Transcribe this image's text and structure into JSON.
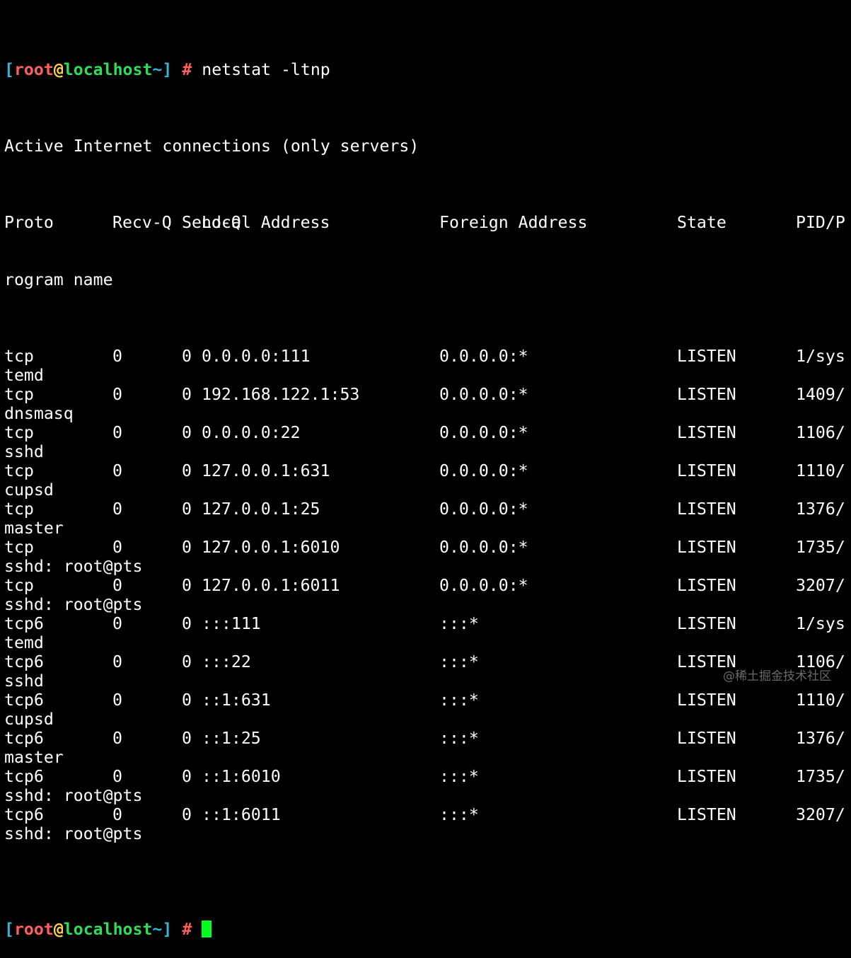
{
  "prompt": {
    "open_bracket": "[",
    "user": "root",
    "at": "@",
    "host": "localhost",
    "tilde": "~",
    "close_bracket": "]",
    "hash": "#"
  },
  "command": "netstat -ltnp",
  "title_line": "Active Internet connections (only servers)",
  "header": {
    "proto": "Proto",
    "recvq": "Recv-Q",
    "sendq": "Send-Q",
    "local": "Local Address",
    "foreign": "Foreign Address",
    "state": "State",
    "pid_head": "PID/P",
    "pid_tail": "rogram name"
  },
  "rows": [
    {
      "proto": "tcp",
      "recvq": "0",
      "sendq": "0",
      "local": "0.0.0.0:111",
      "foreign": "0.0.0.0:*",
      "state": "LISTEN",
      "pid_head": "1/sys",
      "pid_tail": "temd"
    },
    {
      "proto": "tcp",
      "recvq": "0",
      "sendq": "0",
      "local": "192.168.122.1:53",
      "foreign": "0.0.0.0:*",
      "state": "LISTEN",
      "pid_head": "1409/",
      "pid_tail": "dnsmasq"
    },
    {
      "proto": "tcp",
      "recvq": "0",
      "sendq": "0",
      "local": "0.0.0.0:22",
      "foreign": "0.0.0.0:*",
      "state": "LISTEN",
      "pid_head": "1106/",
      "pid_tail": "sshd"
    },
    {
      "proto": "tcp",
      "recvq": "0",
      "sendq": "0",
      "local": "127.0.0.1:631",
      "foreign": "0.0.0.0:*",
      "state": "LISTEN",
      "pid_head": "1110/",
      "pid_tail": "cupsd"
    },
    {
      "proto": "tcp",
      "recvq": "0",
      "sendq": "0",
      "local": "127.0.0.1:25",
      "foreign": "0.0.0.0:*",
      "state": "LISTEN",
      "pid_head": "1376/",
      "pid_tail": "master"
    },
    {
      "proto": "tcp",
      "recvq": "0",
      "sendq": "0",
      "local": "127.0.0.1:6010",
      "foreign": "0.0.0.0:*",
      "state": "LISTEN",
      "pid_head": "1735/",
      "pid_tail": "sshd: root@pts"
    },
    {
      "proto": "tcp",
      "recvq": "0",
      "sendq": "0",
      "local": "127.0.0.1:6011",
      "foreign": "0.0.0.0:*",
      "state": "LISTEN",
      "pid_head": "3207/",
      "pid_tail": "sshd: root@pts"
    },
    {
      "proto": "tcp6",
      "recvq": "0",
      "sendq": "0",
      "local": ":::111",
      "foreign": ":::*",
      "state": "LISTEN",
      "pid_head": "1/sys",
      "pid_tail": "temd"
    },
    {
      "proto": "tcp6",
      "recvq": "0",
      "sendq": "0",
      "local": ":::22",
      "foreign": ":::*",
      "state": "LISTEN",
      "pid_head": "1106/",
      "pid_tail": "sshd"
    },
    {
      "proto": "tcp6",
      "recvq": "0",
      "sendq": "0",
      "local": "::1:631",
      "foreign": ":::*",
      "state": "LISTEN",
      "pid_head": "1110/",
      "pid_tail": "cupsd"
    },
    {
      "proto": "tcp6",
      "recvq": "0",
      "sendq": "0",
      "local": "::1:25",
      "foreign": ":::*",
      "state": "LISTEN",
      "pid_head": "1376/",
      "pid_tail": "master"
    },
    {
      "proto": "tcp6",
      "recvq": "0",
      "sendq": "0",
      "local": "::1:6010",
      "foreign": ":::*",
      "state": "LISTEN",
      "pid_head": "1735/",
      "pid_tail": "sshd: root@pts"
    },
    {
      "proto": "tcp6",
      "recvq": "0",
      "sendq": "0",
      "local": "::1:6011",
      "foreign": ":::*",
      "state": "LISTEN",
      "pid_head": "3207/",
      "pid_tail": "sshd: root@pts"
    }
  ],
  "watermark": "@稀土掘金技术社区",
  "colors": {
    "background": "#000000",
    "text": "#ffffff",
    "bracket": "#2fb8d8",
    "user": "#ff5f5f",
    "at": "#ffd24a",
    "host": "#2fdd5a",
    "cursor": "#00ff1e"
  }
}
